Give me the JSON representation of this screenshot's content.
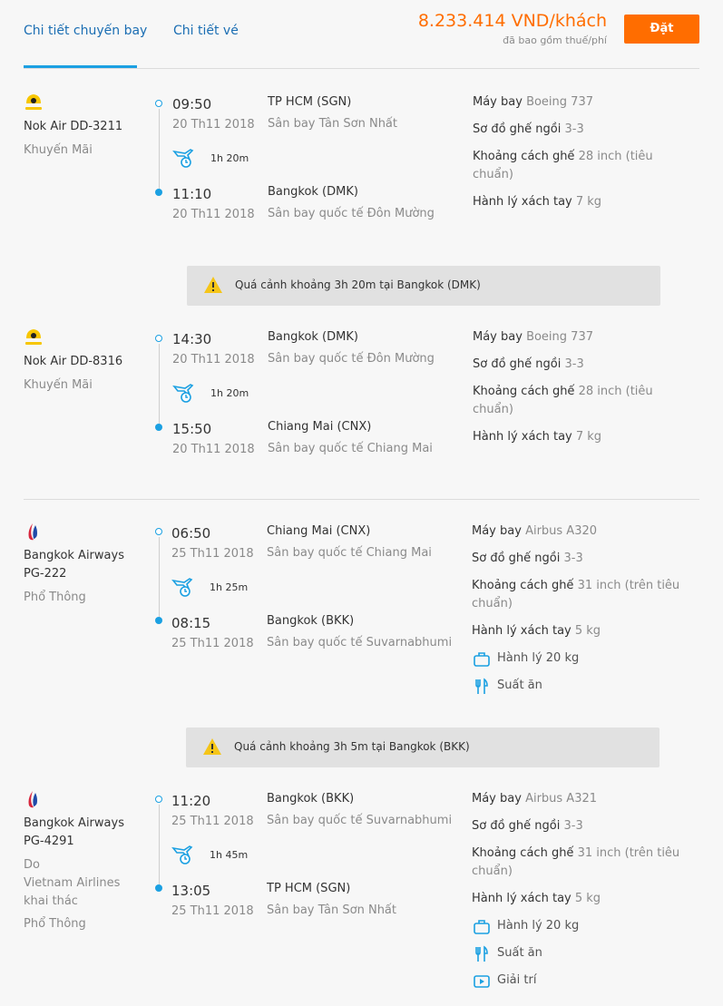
{
  "tabs": {
    "flight_details": "Chi tiết chuyến bay",
    "ticket_details": "Chi tiết vé"
  },
  "price": {
    "amount": "8.233.414 VND/khách",
    "note": "đã bao gồm thuế/phí"
  },
  "book_button": "Đặt",
  "labels": {
    "aircraft": "Máy bay",
    "seat_layout": "Sơ đồ ghế ngồi",
    "seat_pitch": "Khoảng cách ghế",
    "cabin_bag": "Hành lý xách tay"
  },
  "segments": [
    {
      "airline": "Nok Air DD-3211",
      "class": "Khuyến Mãi",
      "dep_time": "09:50",
      "dep_date": "20 Th11 2018",
      "dep_city": "TP HCM (SGN)",
      "dep_airport": "Sân bay Tân Sơn Nhất",
      "duration": "1h 20m",
      "arr_time": "11:10",
      "arr_date": "20 Th11 2018",
      "arr_city": "Bangkok (DMK)",
      "arr_airport": "Sân bay quốc tế Đôn Mường",
      "aircraft": "Boeing 737",
      "seat_layout": "3-3",
      "seat_pitch_a": "28 inch (tiêu",
      "seat_pitch_b": "chuẩn)",
      "cabin_bag": "7 kg"
    },
    {
      "airline": "Nok Air DD-8316",
      "class": "Khuyến Mãi",
      "dep_time": "14:30",
      "dep_date": "20 Th11 2018",
      "dep_city": "Bangkok (DMK)",
      "dep_airport": "Sân bay quốc tế Đôn Mường",
      "duration": "1h 20m",
      "arr_time": "15:50",
      "arr_date": "20 Th11 2018",
      "arr_city": "Chiang Mai (CNX)",
      "arr_airport": "Sân bay quốc tế Chiang Mai",
      "aircraft": "Boeing 737",
      "seat_layout": "3-3",
      "seat_pitch_a": "28 inch (tiêu",
      "seat_pitch_b": "chuẩn)",
      "cabin_bag": "7 kg"
    },
    {
      "airline_a": "Bangkok Airways",
      "airline_b": "PG-222",
      "class": "Phổ Thông",
      "dep_time": "06:50",
      "dep_date": "25 Th11 2018",
      "dep_city": "Chiang Mai (CNX)",
      "dep_airport": "Sân bay quốc tế Chiang Mai",
      "duration": "1h 25m",
      "arr_time": "08:15",
      "arr_date": "25 Th11 2018",
      "arr_city": "Bangkok (BKK)",
      "arr_airport": "Sân bay quốc tế Suvarnabhumi",
      "aircraft": "Airbus A320",
      "seat_layout": "3-3",
      "seat_pitch_a": "31 inch (trên tiêu",
      "seat_pitch_b": "chuẩn)",
      "cabin_bag": "5 kg",
      "checked_bag": "Hành lý 20 kg",
      "meal": "Suất ăn"
    },
    {
      "airline_a": "Bangkok Airways",
      "airline_b": "PG-4291",
      "operated_a": "Do",
      "operated_b": "Vietnam Airlines",
      "operated_c": "khai thác",
      "class": "Phổ Thông",
      "dep_time": "11:20",
      "dep_date": "25 Th11 2018",
      "dep_city": "Bangkok (BKK)",
      "dep_airport": "Sân bay quốc tế Suvarnabhumi",
      "duration": "1h 45m",
      "arr_time": "13:05",
      "arr_date": "25 Th11 2018",
      "arr_city": "TP HCM (SGN)",
      "arr_airport": "Sân bay Tân Sơn Nhất",
      "aircraft": "Airbus A321",
      "seat_layout": "3-3",
      "seat_pitch_a": "31 inch (trên tiêu",
      "seat_pitch_b": "chuẩn)",
      "cabin_bag": "5 kg",
      "checked_bag": "Hành lý 20 kg",
      "meal": "Suất ăn",
      "entertainment": "Giải trí"
    }
  ],
  "layovers": [
    "Quá cảnh khoảng 3h 20m tại Bangkok (DMK)",
    "Quá cảnh khoảng 3h 5m tại Bangkok (BKK)"
  ],
  "icons": {
    "nok_air_logo": "nok-air-bird-logo",
    "bangkok_airways_logo": "bangkok-airways-flame-logo",
    "duration": "plane-clock-icon",
    "warning": "warning-triangle-icon",
    "baggage": "suitcase-icon",
    "meal": "fork-knife-icon",
    "entertainment": "tv-play-icon"
  },
  "colors": {
    "accent_blue": "#1ba0e2",
    "price_orange": "#ff6d00",
    "warning_yellow": "#f5c518"
  }
}
